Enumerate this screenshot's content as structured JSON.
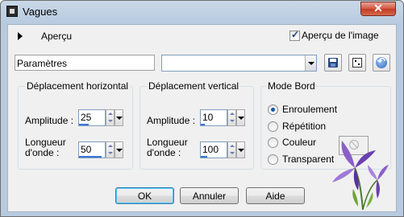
{
  "window": {
    "title": "Vagues",
    "close_glyph": "✕"
  },
  "preview": {
    "expander_label": "Aperçu",
    "checkbox_label": "Aperçu de l'image",
    "checked": true
  },
  "presets": {
    "label": "Paramètres",
    "selected": ""
  },
  "horizontal": {
    "title": "Déplacement horizontal",
    "amplitude_label": "Amplitude :",
    "amplitude_value": "25",
    "wavelength_label_1": "Longueur",
    "wavelength_label_2": "d'onde :",
    "wavelength_value": "50"
  },
  "vertical": {
    "title": "Déplacement vertical",
    "amplitude_label": "Amplitude :",
    "amplitude_value": "10",
    "wavelength_label_1": "Longueur",
    "wavelength_label_2": "d'onde :",
    "wavelength_value": "100"
  },
  "edge_mode": {
    "title": "Mode Bord",
    "options": [
      "Enroulement",
      "Répétition",
      "Couleur",
      "Transparent"
    ],
    "selected": "Enroulement"
  },
  "buttons": {
    "ok": "OK",
    "cancel": "Annuler",
    "help": "Aide"
  },
  "icons": {
    "app": "app-icon",
    "expander": "triangle-right-icon",
    "save": "floppy-disk-icon",
    "randomize": "dice-icon",
    "reset": "reset-icon",
    "no_color": "no-color-icon"
  },
  "colors": {
    "accent": "#3a77d9",
    "title_bar": "#b7cadf",
    "close": "#c23b22"
  }
}
